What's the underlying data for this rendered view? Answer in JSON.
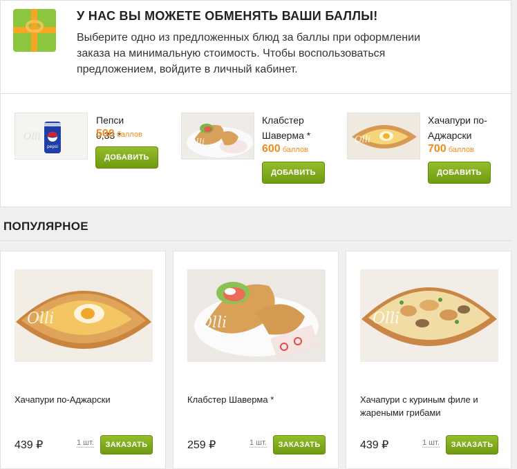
{
  "promo": {
    "title": "У НАС ВЫ МОЖЕТЕ ОБМЕНЯТЬ ВАШИ БАЛЛЫ!",
    "text": "Выберите одно из предложенных блюд за баллы при оформлении заказа на минимальную стоимость. Чтобы воспользоваться предложением, войдите в личный кабинет.",
    "offers": [
      {
        "name": "Пепси 0,33 *",
        "price": "500",
        "unit": "баллов",
        "button": "ДОБАВИТЬ"
      },
      {
        "name": "Клабстер Шаверма *",
        "price": "600",
        "unit": "баллов",
        "button": "ДОБАВИТЬ"
      },
      {
        "name": "Хачапури по-Аджарски",
        "price": "700",
        "unit": "баллов",
        "button": "ДОБАВИТЬ"
      }
    ]
  },
  "popular": {
    "title": "ПОПУЛЯРНОЕ",
    "items": [
      {
        "name": "Хачапури по-Аджарски",
        "price": "439 ₽",
        "qty": "1 шт.",
        "button": "ЗАКАЗАТЬ"
      },
      {
        "name": "Клабстер Шаверма *",
        "price": "259 ₽",
        "qty": "1 шт.",
        "button": "ЗАКАЗАТЬ"
      },
      {
        "name": "Хачапури с куриным филе и жареными грибами",
        "price": "439 ₽",
        "qty": "1 шт.",
        "button": "ЗАКАЗАТЬ"
      }
    ]
  },
  "colors": {
    "accent": "#7ea81c",
    "points": "#f08c1e"
  }
}
